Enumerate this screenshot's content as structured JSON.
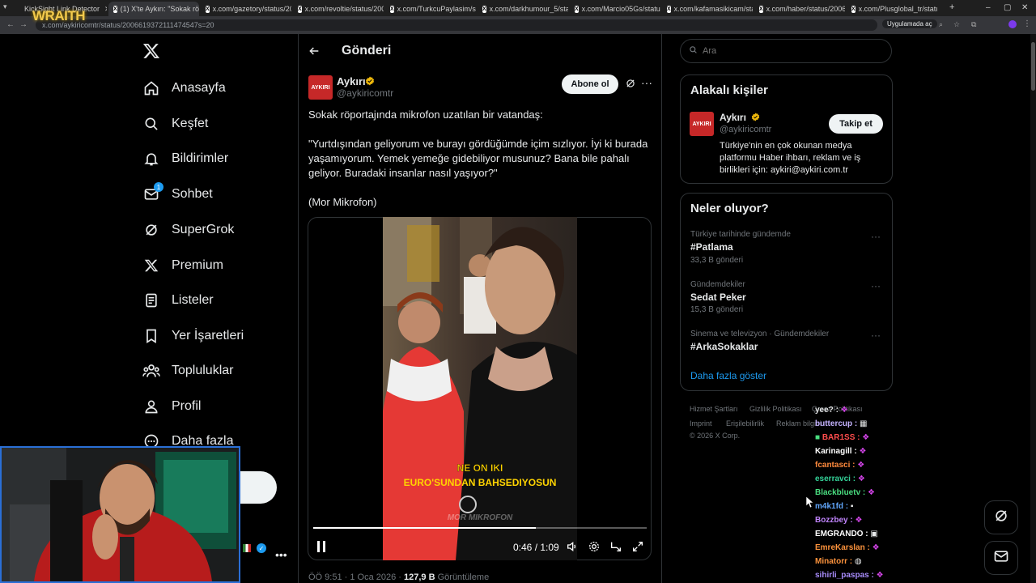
{
  "browser": {
    "tabs": [
      {
        "title": "KickSight Link Detector",
        "active": false
      },
      {
        "title": "(1) X'te Aykırı: \"Sokak röp",
        "active": true
      },
      {
        "title": "x.com/gazetory/status/20061",
        "active": false
      },
      {
        "title": "x.com/revoltie/status/20064",
        "active": false
      },
      {
        "title": "x.com/TurkcuPaylasim/status/",
        "active": false
      },
      {
        "title": "x.com/darkhumour_5/status/",
        "active": false
      },
      {
        "title": "x.com/Marcio05Gs/status/20",
        "active": false
      },
      {
        "title": "x.com/kafamasikicam/status/",
        "active": false
      },
      {
        "title": "x.com/haber/status/20067341",
        "active": false
      },
      {
        "title": "x.com/Plusglobal_tr/status/20",
        "active": false
      }
    ],
    "url": "x.com/aykiricomtr/status/2006619372111474547s=20",
    "app_chip": "Uygulamada aç",
    "overlay_logo": "WRAITH"
  },
  "nav": {
    "items": [
      {
        "label": "Anasayfa",
        "icon": "home-icon"
      },
      {
        "label": "Keşfet",
        "icon": "search-icon"
      },
      {
        "label": "Bildirimler",
        "icon": "bell-icon"
      },
      {
        "label": "Sohbet",
        "icon": "mail-icon",
        "badge": "1"
      },
      {
        "label": "SuperGrok",
        "icon": "grok-icon"
      },
      {
        "label": "Premium",
        "icon": "x-logo-icon"
      },
      {
        "label": "Listeler",
        "icon": "list-icon"
      },
      {
        "label": "Yer İşaretleri",
        "icon": "bookmark-icon"
      },
      {
        "label": "Topluluklar",
        "icon": "people-icon"
      },
      {
        "label": "Profil",
        "icon": "profile-icon"
      },
      {
        "label": "Daha fazla",
        "icon": "more-circle-icon"
      }
    ],
    "post_button_fragment": "a"
  },
  "post": {
    "header": "Gönderi",
    "author_name": "Aykırı",
    "author_handle": "@aykiricomtr",
    "avatar_text": "AYKIRI",
    "follow_label": "Abone ol",
    "text_lines": [
      "Sokak röportajında mikrofon uzatılan bir vatandaş:",
      "\"Yurtdışından geliyorum ve burayı gördüğümde içim sızlıyor. İyi ki burada",
      "yaşamıyorum. Yemek yemeğe gidebiliyor musunuz? Bana bile pahalı",
      "geliyor. Buradaki insanlar nasıl yaşıyor?\"",
      "(Mor Mikrofon)"
    ],
    "video": {
      "subtitle_line1": "NE ON IKI",
      "subtitle_line2": "EURO'SUNDAN BAHSEDIYOSUN",
      "watermark": "MOR MIKROFON",
      "time": "0:46 / 1:09",
      "progress": 0.667
    },
    "meta_time": "ÖÖ 9:51 · 1 Oca 2026 · ",
    "meta_views": "127,9 B",
    "meta_views_label": " Görüntüleme"
  },
  "sidebar": {
    "search_placeholder": "Ara",
    "related_title": "Alakalı kişiler",
    "related": {
      "name": "Aykırı",
      "handle": "@aykiricomtr",
      "avatar_text": "AYKIRI",
      "follow_label": "Takip et",
      "bio_lines": [
        "Türkiye'nin en çok okunan medya",
        "platformu Haber ihbarı, reklam ve iş",
        "birlikleri için: aykiri@aykiri.com.tr"
      ]
    },
    "trends_title": "Neler oluyor?",
    "trends": [
      {
        "category": "Türkiye tarihinde gündemde",
        "name": "#Patlama",
        "count": "33,3 B gönderi"
      },
      {
        "category": "Gündemdekiler",
        "name": "Sedat Peker",
        "count": "15,3 B gönderi"
      },
      {
        "category": "Sinema ve televizyon · Gündemdekiler",
        "name": "#ArkaSokaklar",
        "count": ""
      }
    ],
    "show_more": "Daha fazla göster",
    "footer": {
      "terms": "Hizmet Şartları",
      "privacy": "Gizlilik Politikası",
      "cookie": "Çerez Politikası",
      "imprint": "Imprint",
      "accessibility": "Erişilebilirlik",
      "ads": "Reklam bilgisi",
      "copyright": "© 2026 X Corp."
    }
  },
  "chat": [
    {
      "user": "yee? :",
      "color": "#e7e9ea"
    },
    {
      "user": "buttercup :",
      "color": "#c5b3ff"
    },
    {
      "user": "BAR1SS :",
      "color": "#ff4d4d"
    },
    {
      "user": "Karinagill :",
      "color": "#ffffff"
    },
    {
      "user": "fcantasci :",
      "color": "#ff8a3d"
    },
    {
      "user": "eserravci :",
      "color": "#34d399"
    },
    {
      "user": "Blackbluetv :",
      "color": "#4ade80"
    },
    {
      "user": "m4k1fd :",
      "color": "#60a5fa"
    },
    {
      "user": "Bozzbey :",
      "color": "#c084fc"
    },
    {
      "user": "EMGRANDO :",
      "color": "#ffffff"
    },
    {
      "user": "EmreKarslan :",
      "color": "#fb923c"
    },
    {
      "user": "Minatorr :",
      "color": "#fb923c"
    },
    {
      "user": "sihirli_paspas :",
      "color": "#a78bfa"
    }
  ],
  "colors": {
    "accent": "#1d9bf0",
    "background": "#000000",
    "border": "#2f3336",
    "muted": "#71767b",
    "verified": "#f0b90b"
  }
}
